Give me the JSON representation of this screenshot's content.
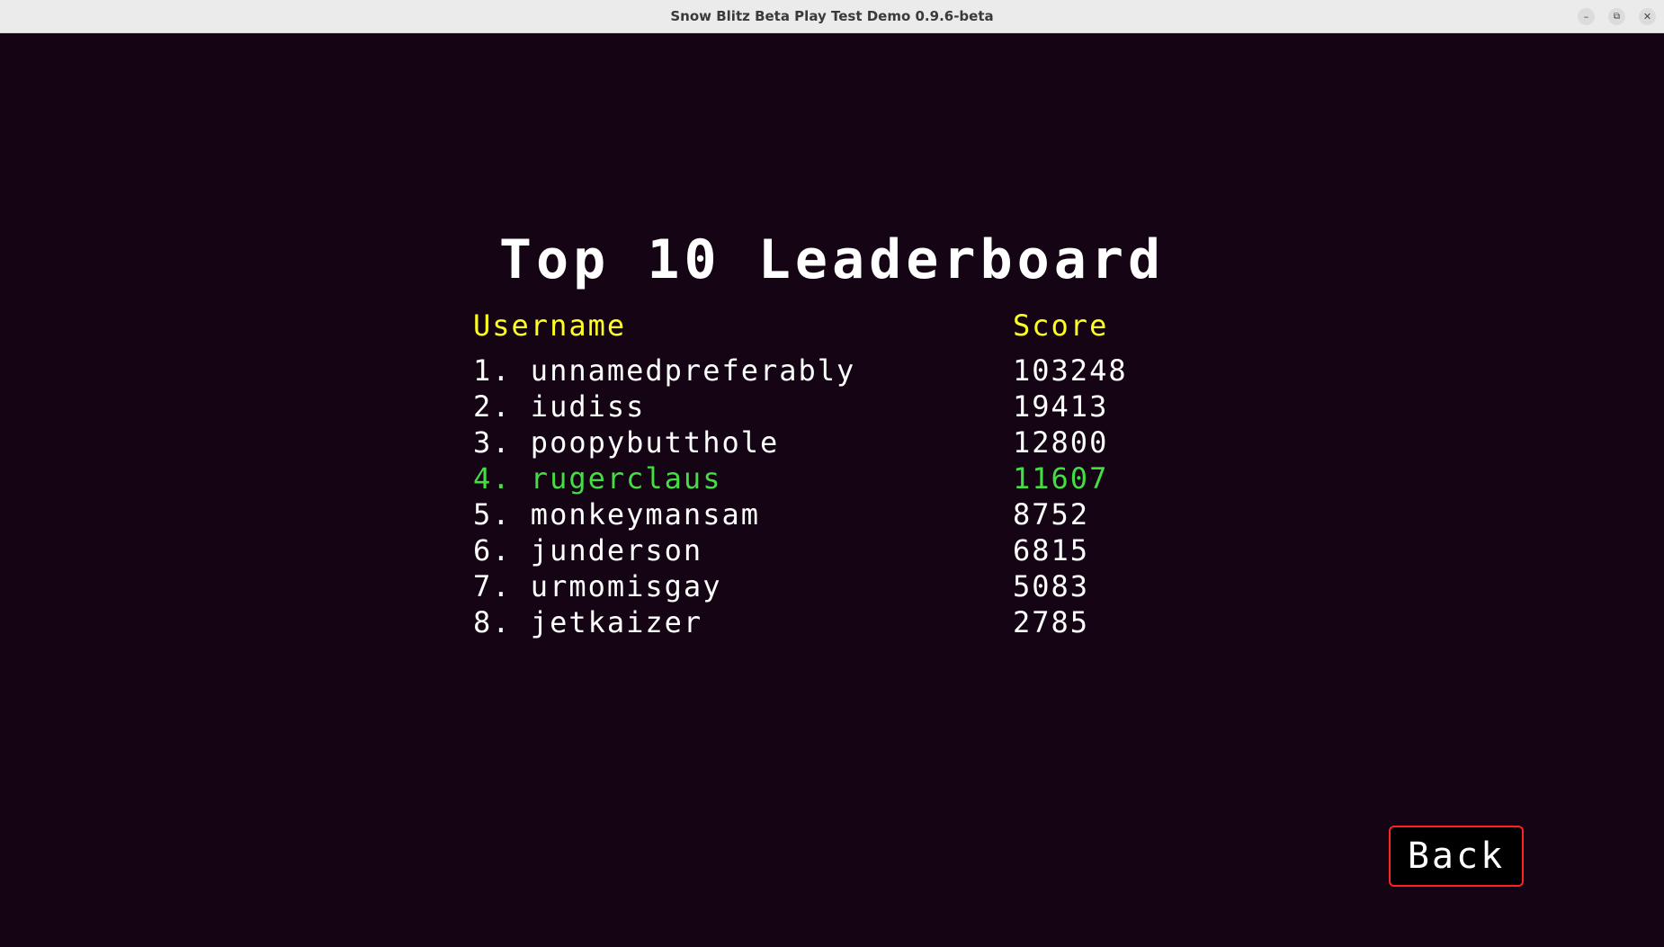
{
  "window": {
    "title": "Snow Blitz Beta Play Test Demo 0.9.6-beta",
    "minimize_icon": "minimize-icon",
    "maximize_icon": "restore-icon",
    "close_icon": "close-icon",
    "minimize_glyph": "–",
    "maximize_glyph": "⧉",
    "close_glyph": "✕"
  },
  "leaderboard": {
    "heading": "Top 10 Leaderboard",
    "username_header": "Username",
    "score_header": "Score",
    "colors": {
      "background": "#140414",
      "header": "#ffff22",
      "entry": "#ffffff",
      "highlight": "#44dd44",
      "back_border": "#ff2222"
    },
    "entries": [
      {
        "name": "1. unnamedpreferably",
        "score": "103248",
        "highlight": false
      },
      {
        "name": "2. iudiss",
        "score": "19413",
        "highlight": false
      },
      {
        "name": "3. poopybutthole",
        "score": "12800",
        "highlight": false
      },
      {
        "name": "4. rugerclaus",
        "score": "11607",
        "highlight": true
      },
      {
        "name": "5. monkeymansam",
        "score": "8752",
        "highlight": false
      },
      {
        "name": "6. junderson",
        "score": "6815",
        "highlight": false
      },
      {
        "name": "7. urmomisgay",
        "score": "5083",
        "highlight": false
      },
      {
        "name": "8. jetkaizer",
        "score": "2785",
        "highlight": false
      }
    ]
  },
  "back_button": {
    "label": "Back"
  }
}
